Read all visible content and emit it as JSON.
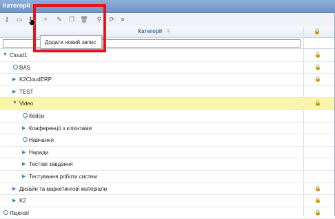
{
  "window": {
    "title": "Категорії"
  },
  "toolbar": {
    "icons": [
      "key-icon",
      "folder-icon",
      "cut-icon",
      "add-icon",
      "edit-icon",
      "copy-icon",
      "delete-icon",
      "search-icon",
      "refresh-icon",
      "list-icon"
    ]
  },
  "grid": {
    "column_header": "Категорії",
    "sort_glyph": "≑",
    "lock_header": "🔒"
  },
  "tooltip": {
    "text": "Додати новий запис"
  },
  "rows": [
    {
      "label": "Cloud1",
      "type": "expanded",
      "level": 0,
      "locked": true
    },
    {
      "label": "BAS",
      "type": "leaf",
      "level": 1,
      "locked": true
    },
    {
      "label": "K2CloudERP",
      "type": "collapsed",
      "level": 1,
      "locked": true
    },
    {
      "label": "TEST",
      "type": "collapsed",
      "level": 1,
      "locked": false
    },
    {
      "label": "Video",
      "type": "expanded",
      "level": 1,
      "locked": true,
      "selected": true
    },
    {
      "label": "Кейси",
      "type": "leaf",
      "level": 2,
      "locked": false
    },
    {
      "label": "Конференції з клієнтами",
      "type": "collapsed",
      "level": 2,
      "locked": false
    },
    {
      "label": "Навчання",
      "type": "leaf",
      "level": 2,
      "locked": false
    },
    {
      "label": "Наради",
      "type": "collapsed",
      "level": 2,
      "locked": false
    },
    {
      "label": "Тестові завдання",
      "type": "collapsed",
      "level": 2,
      "locked": false
    },
    {
      "label": "Тестування роботи систем",
      "type": "collapsed",
      "level": 2,
      "locked": false
    },
    {
      "label": "Дизайн та маркетингові матеріали",
      "type": "collapsed",
      "level": 1,
      "locked": true
    },
    {
      "label": "K2",
      "type": "collapsed",
      "level": 1,
      "locked": true
    },
    {
      "label": "Ліцензії",
      "type": "leaf",
      "level": 0,
      "locked": true
    }
  ]
}
